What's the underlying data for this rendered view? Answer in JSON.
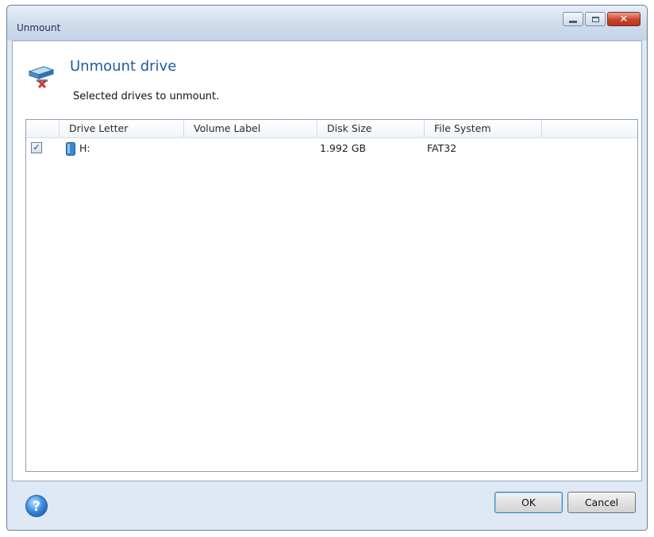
{
  "window": {
    "title": "Unmount"
  },
  "header": {
    "heading": "Unmount drive",
    "description": "Selected drives to unmount."
  },
  "list": {
    "columns": [
      "Drive Letter",
      "Volume Label",
      "Disk Size",
      "File System"
    ],
    "rows": [
      {
        "checked": true,
        "drive_letter": "H:",
        "volume_label": "",
        "disk_size": "1.992 GB",
        "file_system": "FAT32"
      }
    ]
  },
  "footer": {
    "ok_label": "OK",
    "cancel_label": "Cancel"
  },
  "icons": {
    "header": "unmount-drive-icon",
    "row": "drive-icon",
    "help": "help-icon",
    "minimize": "minimize-icon",
    "maximize": "maximize-icon",
    "close": "close-icon"
  },
  "colors": {
    "heading": "#1f5aa6",
    "window_frame": "#dfe9f5",
    "close_button": "#c8452b"
  }
}
